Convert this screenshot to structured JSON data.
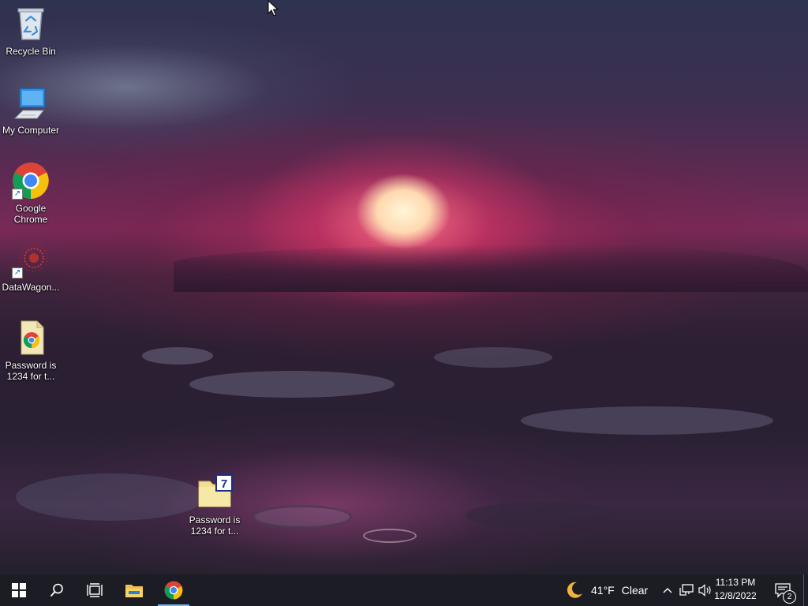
{
  "desktop": {
    "icons": [
      {
        "label": "Recycle Bin"
      },
      {
        "label": "My Computer"
      },
      {
        "label": "Google\nChrome"
      },
      {
        "label": "DataWagon..."
      },
      {
        "label": "Password is\n1234 for t..."
      },
      {
        "label": "Password is\n1234 for t..."
      }
    ]
  },
  "taskbar": {
    "weather": {
      "temp": "41°F",
      "condition": "Clear"
    },
    "clock": {
      "time": "11:13 PM",
      "date": "12/8/2022"
    },
    "notifications": {
      "count": "2"
    }
  },
  "colors": {
    "taskbar": "#1c1c24",
    "active_indicator": "#79b8f3"
  }
}
